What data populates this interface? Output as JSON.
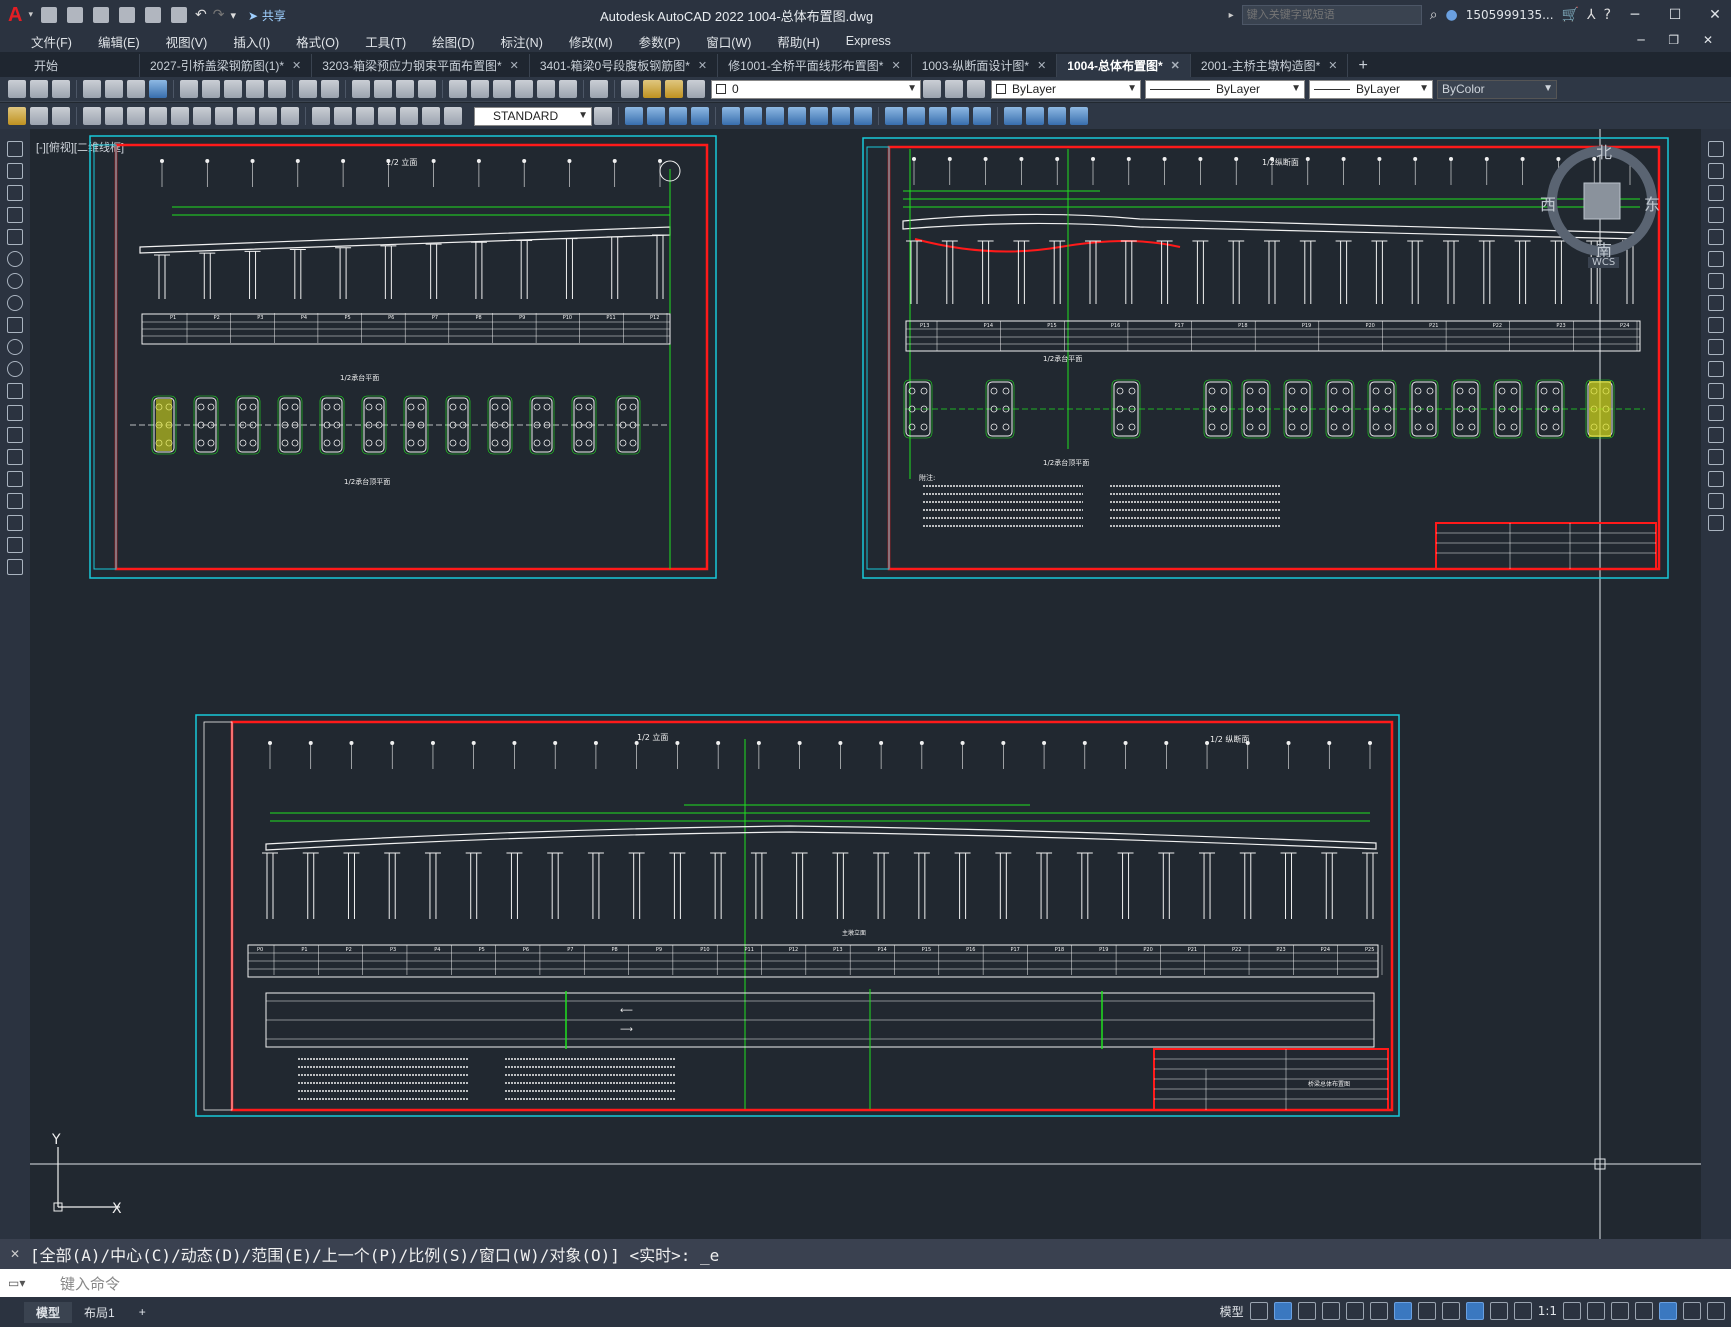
{
  "titlebar": {
    "app_title": "Autodesk AutoCAD 2022    1004-总体布置图.dwg",
    "share_label": "共享",
    "search_placeholder": "键入关键字或短语",
    "user": "1505999135..."
  },
  "menu": [
    "文件(F)",
    "编辑(E)",
    "视图(V)",
    "插入(I)",
    "格式(O)",
    "工具(T)",
    "绘图(D)",
    "标注(N)",
    "修改(M)",
    "参数(P)",
    "窗口(W)",
    "帮助(H)",
    "Express"
  ],
  "tabs": [
    {
      "label": "开始",
      "active": false,
      "closable": false
    },
    {
      "label": "2027-引桥盖梁钢筋图(1)*",
      "active": false,
      "closable": true
    },
    {
      "label": "3203-箱梁预应力钢束平面布置图*",
      "active": false,
      "closable": true
    },
    {
      "label": "3401-箱梁0号段腹板钢筋图*",
      "active": false,
      "closable": true
    },
    {
      "label": "修1001-全桥平面线形布置图*",
      "active": false,
      "closable": true
    },
    {
      "label": "1003-纵断面设计图*",
      "active": false,
      "closable": true
    },
    {
      "label": "1004-总体布置图*",
      "active": true,
      "closable": true
    },
    {
      "label": "2001-主桥主墩构造图*",
      "active": false,
      "closable": true
    }
  ],
  "properties": {
    "layer": "0",
    "color": "ByLayer",
    "linetype": "ByLayer",
    "lineweight": "ByLayer",
    "plotstyle": "ByColor",
    "textstyle": "STANDARD"
  },
  "viewport": {
    "label": "[-][俯视][二维线框]",
    "viewcube": {
      "north": "北",
      "south": "南",
      "east": "东",
      "west": "西",
      "wcs": "WCS"
    }
  },
  "drawing": {
    "sheet1": {
      "elevation_title": "1/2 立面",
      "plan_title": "1/2承台平面",
      "plan2_title": "1/2承台顶平面",
      "pier_labels": [
        "P1",
        "P2",
        "P3",
        "P4",
        "P5",
        "P6",
        "P7",
        "P8",
        "P9",
        "P10",
        "P11",
        "P12"
      ]
    },
    "sheet2": {
      "elevation_title": "1/2纵断面",
      "plan_title": "1/2承台平面",
      "plan2_title": "1/2承台顶平面",
      "notes_title": "附注:",
      "pier_labels": [
        "P13",
        "P14",
        "P15",
        "P16",
        "P17",
        "P18",
        "P19",
        "P20",
        "P21",
        "P22",
        "P23",
        "P24"
      ]
    },
    "sheet3": {
      "elevation_title": "1/2 立面",
      "elevation_title_right": "1/2 纵断面",
      "section_title": "主墩立面",
      "title_block": "桥梁总体布置图",
      "pier_labels": [
        "P0",
        "P1",
        "P2",
        "P3",
        "P4",
        "P5",
        "P6",
        "P7",
        "P8",
        "P9",
        "P10",
        "P11",
        "P12",
        "P13",
        "P14",
        "P15",
        "P16",
        "P17",
        "P18",
        "P19",
        "P20",
        "P21",
        "P22",
        "P23",
        "P24",
        "P25"
      ]
    }
  },
  "command": {
    "history": "[全部(A)/中心(C)/动态(D)/范围(E)/上一个(P)/比例(S)/窗口(W)/对象(O)] <实时>: _e",
    "placeholder": "键入命令"
  },
  "status": {
    "layout_tabs": [
      {
        "label": "模型",
        "active": true
      },
      {
        "label": "布局1",
        "active": false
      }
    ],
    "model_label": "模型",
    "scale": "1:1"
  },
  "colors": {
    "accent": "#e31e24",
    "cyan": "#18c9d9",
    "green": "#1fe01f",
    "red": "#ff1a1a",
    "bg": "#212830"
  }
}
